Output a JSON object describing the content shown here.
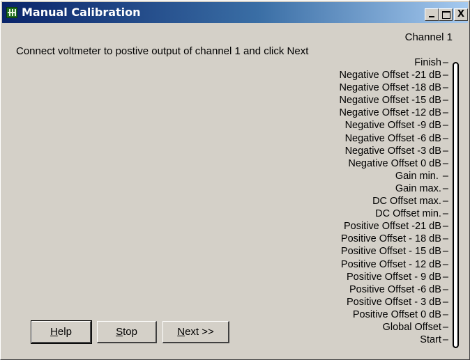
{
  "window": {
    "title": "Manual Calibration",
    "title_buttons": {
      "minimize": "_",
      "maximize": "□",
      "close": "X"
    }
  },
  "channel_label": "Channel 1",
  "instruction": "Connect voltmeter to postive output of channel 1 and click Next",
  "steps": [
    "Finish",
    "Negative Offset -21 dB",
    "Negative Offset -18 dB",
    "Negative Offset -15 dB",
    "Negative Offset -12 dB",
    "Negative Offset -9 dB",
    "Negative Offset -6 dB",
    "Negative Offset -3 dB",
    "Negative Offset 0 dB",
    "Gain min. ",
    "Gain max.",
    "DC Offset max.",
    "DC Offset min.",
    "Positive Offset -21 dB",
    "Positive Offset - 18 dB",
    "Positive Offset - 15 dB",
    "Positive Offset - 12 dB",
    "Positive Offset - 9 dB",
    "Positive Offset -6 dB",
    "Positive Offset - 3 dB",
    "Positive Offset 0 dB",
    "Global Offset",
    "Start"
  ],
  "progress": {
    "current_step": "Start",
    "fraction": 0
  },
  "buttons": {
    "help": {
      "accel": "H",
      "rest": "elp"
    },
    "stop": {
      "accel": "S",
      "rest": "top"
    },
    "next": {
      "accel": "N",
      "rest": "ext >>"
    }
  }
}
